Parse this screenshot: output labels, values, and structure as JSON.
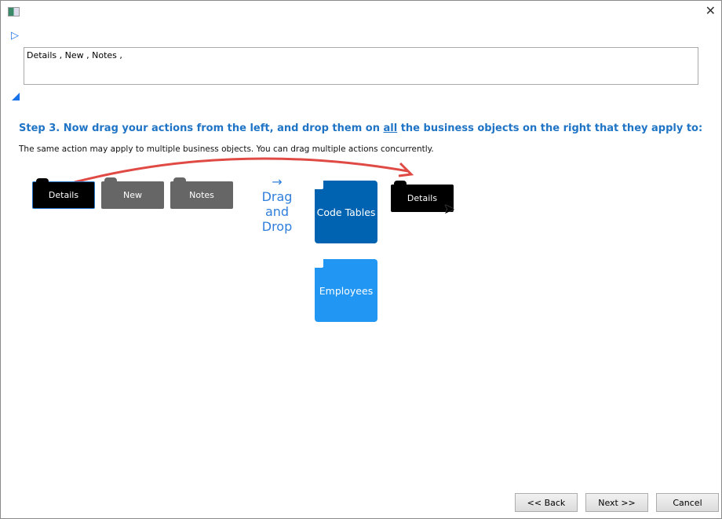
{
  "window": {
    "close": "✕"
  },
  "summary": {
    "text": "Details , New , Notes ,"
  },
  "step": {
    "prefix": "Step 3. Now drag your actions from the left, and drop them on ",
    "emphasis": "all",
    "suffix": " the business objects on the right that they apply to:"
  },
  "subtitle": "The same action may apply to multiple business objects. You can drag multiple actions concurrently.",
  "actions": [
    {
      "label": "Details"
    },
    {
      "label": "New"
    },
    {
      "label": "Notes"
    }
  ],
  "drag": {
    "arrow": "→",
    "line1": "Drag and",
    "line2": "Drop",
    "dragged": "Details"
  },
  "objects": [
    {
      "label": "Code Tables",
      "color": "#0063b1"
    },
    {
      "label": "Employees",
      "color": "#2196f3"
    }
  ],
  "buttons": {
    "back": "<< Back",
    "next": "Next >>",
    "cancel": "Cancel"
  }
}
